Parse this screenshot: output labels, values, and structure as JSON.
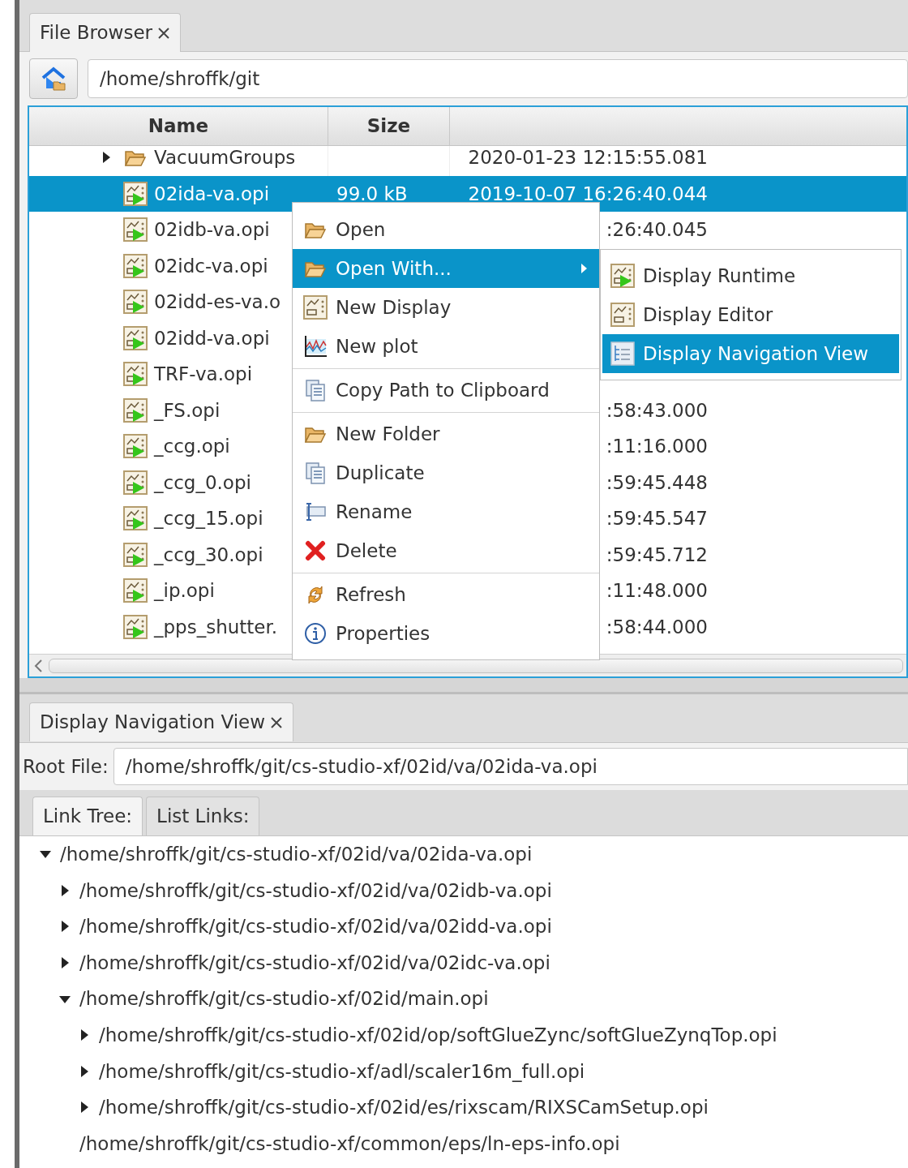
{
  "file_browser": {
    "tab": {
      "label": "File Browser",
      "selected": true
    },
    "path": "/home/shroffk/git",
    "table": {
      "columns": [
        "Name",
        "Size"
      ],
      "rows": [
        {
          "kind": "folder",
          "name": "VacuumGroups",
          "size": "",
          "modified": "2020-01-23 12:15:55.081",
          "selected": false
        },
        {
          "kind": "file",
          "name": "02ida-va.opi",
          "size": "99.0 kB",
          "modified": "2019-10-07 16:26:40.044",
          "selected": true
        },
        {
          "kind": "file",
          "name": "02idb-va.opi",
          "size": "",
          "modified": ":26:40.045",
          "selected": false
        },
        {
          "kind": "file",
          "name": "02idc-va.opi",
          "size": "",
          "modified": "",
          "selected": false
        },
        {
          "kind": "file",
          "name": "02idd-es-va.o",
          "size": "",
          "modified": "",
          "selected": false
        },
        {
          "kind": "file",
          "name": "02idd-va.opi",
          "size": "",
          "modified": "",
          "selected": false
        },
        {
          "kind": "file",
          "name": "TRF-va.opi",
          "size": "",
          "modified": "",
          "selected": false
        },
        {
          "kind": "file",
          "name": "_FS.opi",
          "size": "",
          "modified": ":58:43.000",
          "selected": false
        },
        {
          "kind": "file",
          "name": "_ccg.opi",
          "size": "",
          "modified": ":11:16.000",
          "selected": false
        },
        {
          "kind": "file",
          "name": "_ccg_0.opi",
          "size": "",
          "modified": ":59:45.448",
          "selected": false
        },
        {
          "kind": "file",
          "name": "_ccg_15.opi",
          "size": "",
          "modified": ":59:45.547",
          "selected": false
        },
        {
          "kind": "file",
          "name": "_ccg_30.opi",
          "size": "",
          "modified": ":59:45.712",
          "selected": false
        },
        {
          "kind": "file",
          "name": "_ip.opi",
          "size": "",
          "modified": ":11:48.000",
          "selected": false
        },
        {
          "kind": "file",
          "name": "_pps_shutter.",
          "size": "",
          "modified": ":58:44.000",
          "selected": false
        }
      ]
    }
  },
  "context_menu": {
    "groups": [
      [
        {
          "label": "Open",
          "has_submenu": false,
          "selected": false
        },
        {
          "label": "Open With...",
          "has_submenu": true,
          "selected": true
        },
        {
          "label": "New Display",
          "has_submenu": false,
          "selected": false
        },
        {
          "label": "New plot",
          "has_submenu": false,
          "selected": false
        }
      ],
      [
        {
          "label": "Copy Path to Clipboard",
          "has_submenu": false,
          "selected": false
        }
      ],
      [
        {
          "label": "New Folder",
          "has_submenu": false,
          "selected": false
        },
        {
          "label": "Duplicate",
          "has_submenu": false,
          "selected": false
        },
        {
          "label": "Rename",
          "has_submenu": false,
          "selected": false
        },
        {
          "label": "Delete",
          "has_submenu": false,
          "selected": false
        }
      ],
      [
        {
          "label": "Refresh",
          "has_submenu": false,
          "selected": false
        },
        {
          "label": "Properties",
          "has_submenu": false,
          "selected": false
        }
      ]
    ]
  },
  "submenu": {
    "items": [
      {
        "label": "Display Runtime",
        "selected": false
      },
      {
        "label": "Display Editor",
        "selected": false
      },
      {
        "label": "Display Navigation View",
        "selected": true
      }
    ]
  },
  "navigation_view": {
    "tab": {
      "label": "Display Navigation View",
      "selected": true
    },
    "root_file_label": "Root File:",
    "root_file": "/home/shroffk/git/cs-studio-xf/02id/va/02ida-va.opi",
    "tabs": [
      {
        "label": "Link Tree:",
        "selected": true
      },
      {
        "label": "List Links:",
        "selected": false
      }
    ],
    "tree": [
      {
        "label": "/home/shroffk/git/cs-studio-xf/02id/va/02ida-va.opi",
        "has_children": true,
        "expanded": true,
        "children": [
          {
            "label": "/home/shroffk/git/cs-studio-xf/02id/va/02idb-va.opi",
            "has_children": true,
            "expanded": false
          },
          {
            "label": "/home/shroffk/git/cs-studio-xf/02id/va/02idd-va.opi",
            "has_children": true,
            "expanded": false
          },
          {
            "label": "/home/shroffk/git/cs-studio-xf/02id/va/02idc-va.opi",
            "has_children": true,
            "expanded": false
          },
          {
            "label": "/home/shroffk/git/cs-studio-xf/02id/main.opi",
            "has_children": true,
            "expanded": true,
            "children": [
              {
                "label": "/home/shroffk/git/cs-studio-xf/02id/op/softGlueZync/softGlueZynqTop.opi",
                "has_children": true,
                "expanded": false
              },
              {
                "label": "/home/shroffk/git/cs-studio-xf/adl/scaler16m_full.opi",
                "has_children": true,
                "expanded": false
              },
              {
                "label": "/home/shroffk/git/cs-studio-xf/02id/es/rixscam/RIXSCamSetup.opi",
                "has_children": true,
                "expanded": false
              }
            ]
          },
          {
            "label": "/home/shroffk/git/cs-studio-xf/common/eps/ln-eps-info.opi",
            "has_children": false
          }
        ]
      }
    ]
  }
}
